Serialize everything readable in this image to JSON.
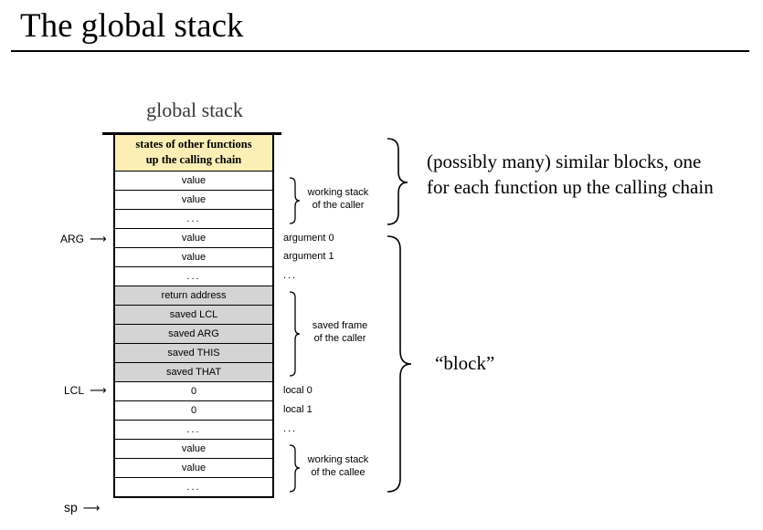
{
  "title": "The global stack",
  "stack_heading": "global stack",
  "stack": {
    "states_line1": "states of other functions",
    "states_line2": "up the calling chain",
    "cells": [
      {
        "text": "value",
        "gray": false
      },
      {
        "text": "value",
        "gray": false
      },
      {
        "text": "...",
        "gray": false
      },
      {
        "text": "value",
        "gray": false
      },
      {
        "text": "value",
        "gray": false
      },
      {
        "text": "...",
        "gray": false
      },
      {
        "text": "return address",
        "gray": true
      },
      {
        "text": "saved LCL",
        "gray": true
      },
      {
        "text": "saved ARG",
        "gray": true
      },
      {
        "text": "saved THIS",
        "gray": true
      },
      {
        "text": "saved THAT",
        "gray": true
      },
      {
        "text": "0",
        "gray": false
      },
      {
        "text": "0",
        "gray": false
      },
      {
        "text": "...",
        "gray": false
      },
      {
        "text": "value",
        "gray": false
      },
      {
        "text": "value",
        "gray": false
      },
      {
        "text": "...",
        "gray": false
      }
    ]
  },
  "pointers": {
    "arg": "ARG",
    "lcl": "LCL",
    "sp": "sp"
  },
  "side_labels": {
    "argument0": "argument 0",
    "argument1": "argument 1",
    "arg_dots": "...",
    "local0": "local 0",
    "local1": "local 1",
    "local_dots": "..."
  },
  "brace_labels": {
    "caller_ws_line1": "working stack",
    "caller_ws_line2": "of the caller",
    "saved_frame_line1": "saved frame",
    "saved_frame_line2": "of the caller",
    "callee_ws_line1": "working stack",
    "callee_ws_line2": "of the callee"
  },
  "annotations": {
    "similar_line1": "(possibly many) similar blocks, one",
    "similar_line2": "for each function up the calling chain",
    "block": "“block”"
  },
  "colors": {
    "states_fill": "#fdeeb6",
    "frame_fill": "#d4d4d4"
  }
}
